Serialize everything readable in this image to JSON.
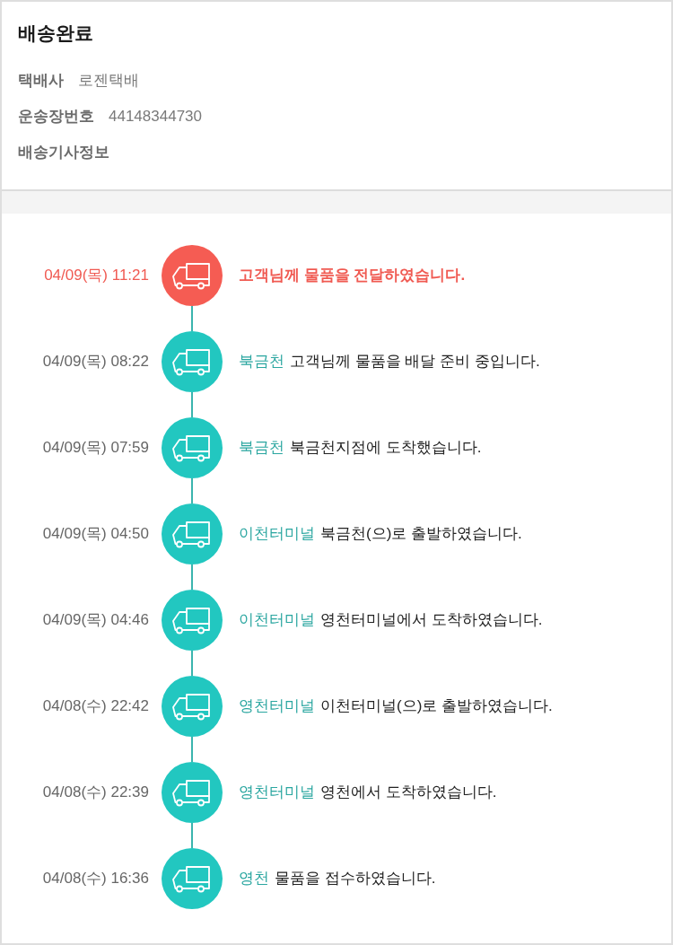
{
  "header": {
    "title": "배송완료",
    "fields": [
      {
        "label": "택배사",
        "value": "로젠택배"
      },
      {
        "label": "운송장번호",
        "value": "44148344730"
      },
      {
        "label": "배송기사정보"
      }
    ]
  },
  "events": [
    {
      "date": "04/09(목) 11:21",
      "message": "고객님께 물품을 전달하였습니다.",
      "current": true
    },
    {
      "date": "04/09(목) 08:22",
      "location": "북금천",
      "message": "고객님께 물품을 배달 준비 중입니다.",
      "current": false
    },
    {
      "date": "04/09(목) 07:59",
      "location": "북금천",
      "message": "북금천지점에 도착했습니다.",
      "current": false
    },
    {
      "date": "04/09(목) 04:50",
      "location": "이천터미널",
      "message": "북금천(으)로 출발하였습니다.",
      "current": false
    },
    {
      "date": "04/09(목) 04:46",
      "location": "이천터미널",
      "message": "영천터미널에서 도착하였습니다.",
      "current": false
    },
    {
      "date": "04/08(수) 22:42",
      "location": "영천터미널",
      "message": "이천터미널(으)로 출발하였습니다.",
      "current": false
    },
    {
      "date": "04/08(수) 22:39",
      "location": "영천터미널",
      "message": "영천에서 도착하였습니다.",
      "current": false
    },
    {
      "date": "04/08(수) 16:36",
      "location": "영천",
      "message": "물품을 접수하였습니다.",
      "current": false
    }
  ]
}
